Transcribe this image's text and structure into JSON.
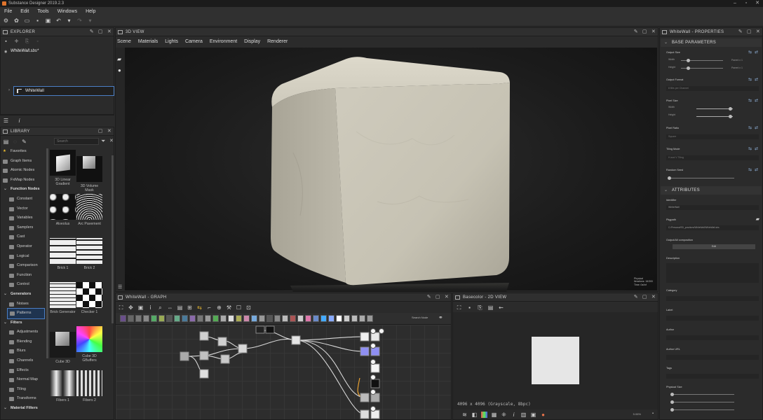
{
  "window": {
    "title": "Substance Designer 2019.2.3",
    "controls": [
      "–",
      "▫",
      "✕"
    ]
  },
  "menu": [
    "File",
    "Edit",
    "Tools",
    "Windows",
    "Help"
  ],
  "explorer": {
    "title": "EXPLORER",
    "package": "WhiteWall.sbs*",
    "graph_item": "WhiteWall"
  },
  "library": {
    "title": "LIBRARY",
    "search_placeholder": "Search",
    "tree": [
      {
        "label": "Favorites",
        "kind": "top"
      },
      {
        "label": "Graph Items",
        "kind": "top"
      },
      {
        "label": "Atomic Nodes",
        "kind": "top"
      },
      {
        "label": "FxMap Nodes",
        "kind": "top"
      },
      {
        "label": "Function Nodes",
        "kind": "head"
      },
      {
        "label": "Constant",
        "kind": "sub"
      },
      {
        "label": "Vector",
        "kind": "sub"
      },
      {
        "label": "Variables",
        "kind": "sub"
      },
      {
        "label": "Samplers",
        "kind": "sub"
      },
      {
        "label": "Cast",
        "kind": "sub"
      },
      {
        "label": "Operator",
        "kind": "sub"
      },
      {
        "label": "Logical",
        "kind": "sub"
      },
      {
        "label": "Comparison",
        "kind": "sub"
      },
      {
        "label": "Function",
        "kind": "sub"
      },
      {
        "label": "Control",
        "kind": "sub"
      },
      {
        "label": "Generators",
        "kind": "head"
      },
      {
        "label": "Noises",
        "kind": "sub"
      },
      {
        "label": "Patterns",
        "kind": "sel"
      },
      {
        "label": "Filters",
        "kind": "head"
      },
      {
        "label": "Adjustments",
        "kind": "sub"
      },
      {
        "label": "Blending",
        "kind": "sub"
      },
      {
        "label": "Blurs",
        "kind": "sub"
      },
      {
        "label": "Channels",
        "kind": "sub"
      },
      {
        "label": "Effects",
        "kind": "sub"
      },
      {
        "label": "Normal Map",
        "kind": "sub"
      },
      {
        "label": "Tiling",
        "kind": "sub"
      },
      {
        "label": "Transforms",
        "kind": "sub"
      },
      {
        "label": "Material Filters",
        "kind": "head"
      }
    ],
    "thumbnails": [
      {
        "label": "3D Linear Gradient"
      },
      {
        "label": "3D Volume Mask"
      },
      {
        "label": "Alveolus"
      },
      {
        "label": "Arc Pavement"
      },
      {
        "label": "Brick 1"
      },
      {
        "label": "Brick 2"
      },
      {
        "label": "Brick Generator"
      },
      {
        "label": "Checker 1"
      },
      {
        "label": "Cube 3D"
      },
      {
        "label": "Cube 3D GBuffers"
      },
      {
        "label": "Fibers 1"
      },
      {
        "label": "Fibers 2"
      }
    ]
  },
  "view3d": {
    "title": "3D VIEW",
    "menu": [
      "Scene",
      "Materials",
      "Lights",
      "Camera",
      "Environment",
      "Display",
      "Renderer"
    ],
    "info": [
      "Physical",
      "Iterations: 16/300",
      "Time: 0s/inf"
    ]
  },
  "graph": {
    "title": "WhiteWall - GRAPH",
    "search_label": "Search Node"
  },
  "view2d": {
    "title": "Basecolor - 2D VIEW",
    "status": "4096 x 4096 (Grayscale, 8bpc)",
    "zoom": "5.06%"
  },
  "properties": {
    "title": "WhiteWall - PROPERTIES",
    "base_section": "BASE PARAMETERS",
    "output_size": "Output Size",
    "width_label": "Width",
    "height_label": "Height",
    "parent_x": "Parent x 1",
    "output_format": "Output Format",
    "output_format_value": "8 Bits per Channel",
    "pixel_size": "Pixel Size",
    "pixel_ratio": "Pixel Ratio",
    "pixel_ratio_value": "Square",
    "tiling_mode": "Tiling Mode",
    "tiling_mode_value": "H and V Tiling",
    "random_seed": "Random Seed",
    "attr_section": "ATTRIBUTES",
    "identifier": "Identifier",
    "identifier_value": "WhiteWall",
    "pkgpath": "Pkgpath",
    "pkgpath_value": "C:/Personal/SD_practices/WhiteWall/WhiteWall.sbs",
    "composition": "Output/All composition",
    "composition_btn": "Edit",
    "description": "Description",
    "category": "Category",
    "label": "Label",
    "author": "Author",
    "author_url": "Author URL",
    "tags": "Tags",
    "physical_size": "Physical Size"
  },
  "colors": {
    "accent": "#4b7fc5",
    "wall": "#d4d0c2",
    "app_bg": "#2b2b2b"
  }
}
